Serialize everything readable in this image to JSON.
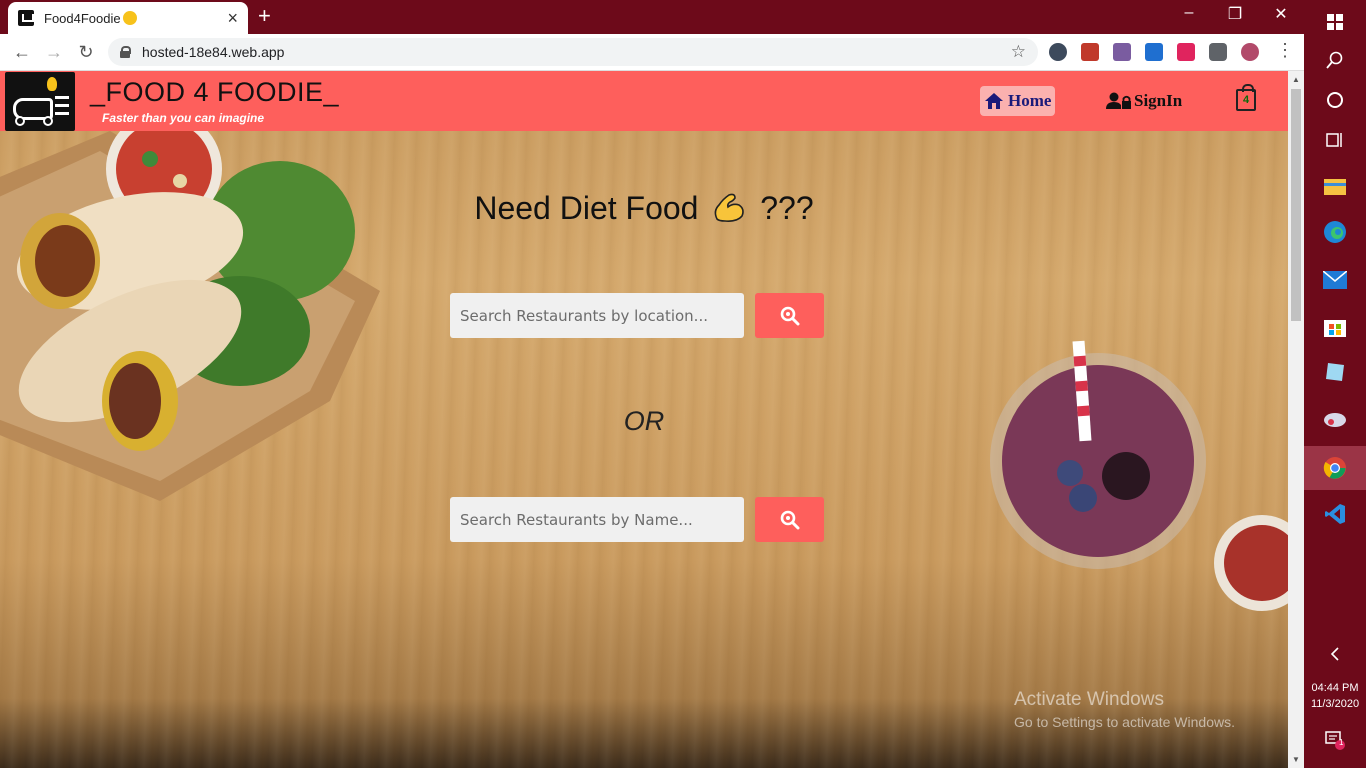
{
  "browser": {
    "tab_title": "Food4Foodie",
    "new_tab_label": "+",
    "url": "hosted-18e84.web.app",
    "window_controls": [
      "–",
      "❐",
      "✕"
    ]
  },
  "navbar": {
    "brand_title": "_FOOD 4 FOODIE_",
    "tagline": "Faster than you can imagine",
    "home_label": "Home",
    "signin_label": "SignIn",
    "cart_count": "4",
    "accent_color": "#fe5f5c"
  },
  "hero": {
    "title_before": "Need Diet Food",
    "title_after": "???",
    "emoji_icon": "flexed-biceps-icon"
  },
  "search": {
    "location_placeholder": "Search Restaurants by location...",
    "name_placeholder": "Search Restaurants by Name...",
    "or_label": "OR"
  },
  "watermark": {
    "title": "Activate Windows",
    "subtitle": "Go to Settings to activate Windows."
  },
  "taskbar": {
    "time": "04:44 PM",
    "date": "11/3/2020",
    "notification_count": "1"
  }
}
